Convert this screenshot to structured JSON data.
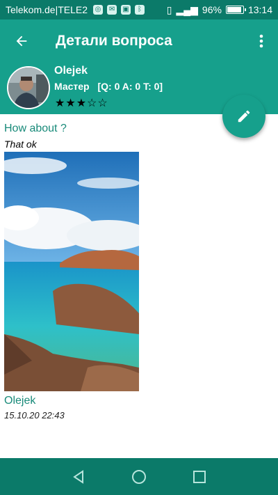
{
  "status_bar": {
    "carrier": "Telekom.de|TELE2",
    "battery_percent": "96%",
    "battery_level": 0.96,
    "time": "13:14",
    "notification_icons": [
      "app-icon",
      "message-icon",
      "gallery-icon",
      "bluetooth-icon"
    ]
  },
  "app_bar": {
    "title": "Детали вопроса"
  },
  "user": {
    "name": "Olejek",
    "rank": "Мастер",
    "stats": "[Q: 0 A: 0 T: 0]",
    "rating": 3,
    "rating_max": 5,
    "stars_text": "★★★☆☆"
  },
  "question": {
    "title": "How about ?",
    "body": "That ok",
    "author": "Olejek",
    "date": "15.10.20 22:43"
  },
  "colors": {
    "primary": "#16a08c",
    "primary_dark": "#0b7a69",
    "accent_text": "#188a79"
  }
}
